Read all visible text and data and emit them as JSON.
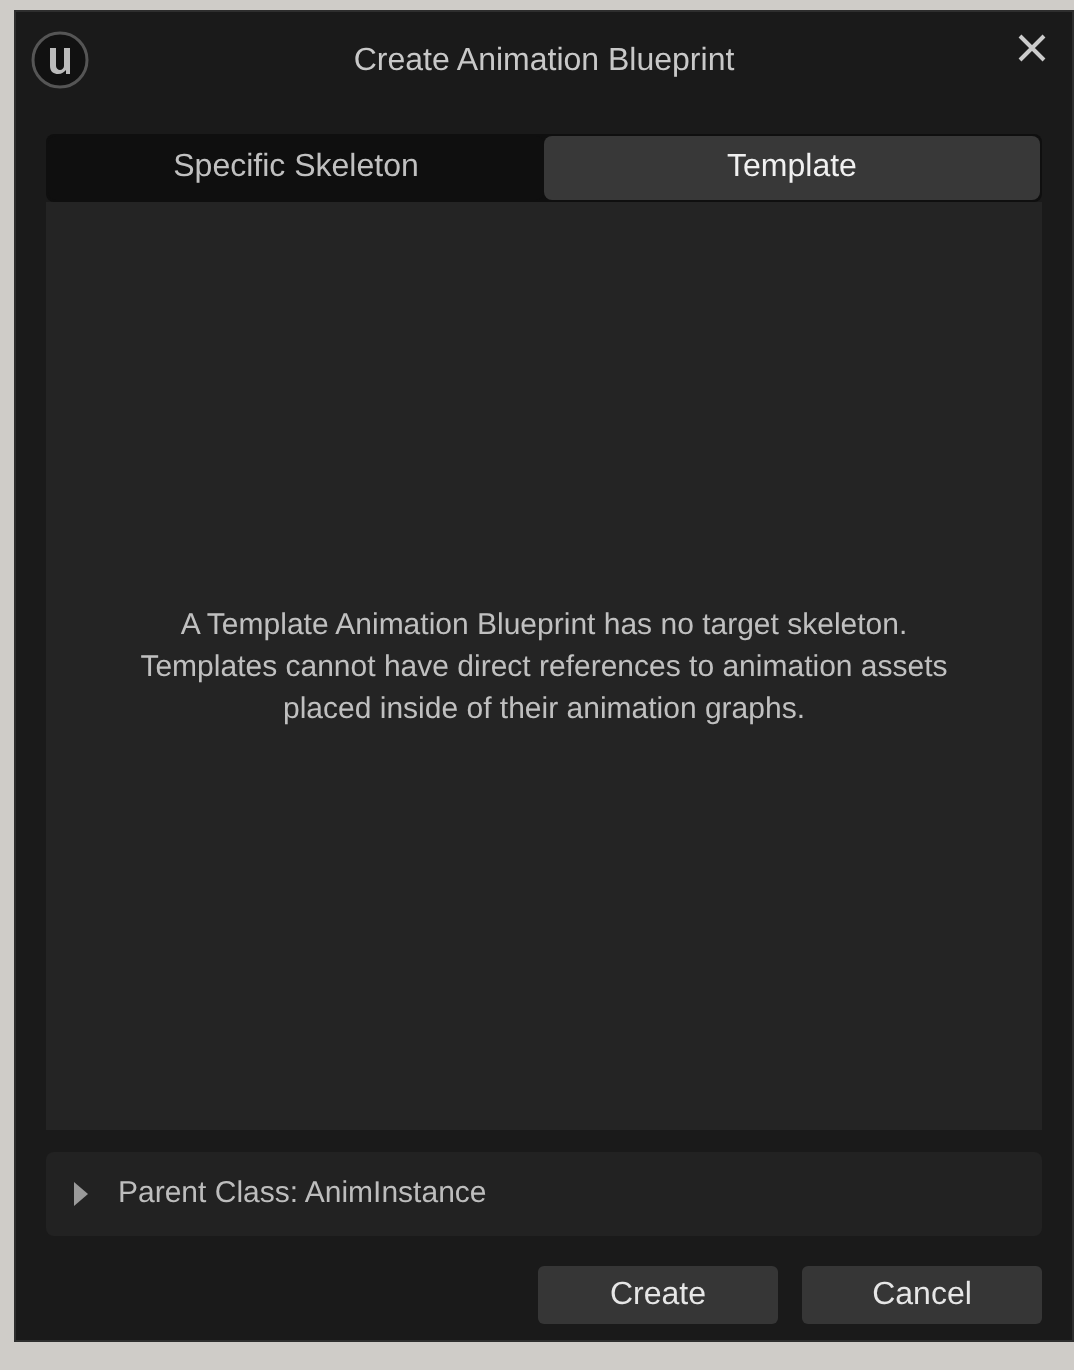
{
  "window": {
    "title": "Create Animation Blueprint"
  },
  "tabs": [
    {
      "label": "Specific Skeleton",
      "selected": false
    },
    {
      "label": "Template",
      "selected": true
    }
  ],
  "description_lines": [
    "A Template Animation Blueprint has no target skeleton.",
    "Templates cannot have direct references to animation assets",
    "placed inside of their animation graphs."
  ],
  "parent_class": {
    "label": "Parent Class: AnimInstance",
    "expanded": false
  },
  "buttons": [
    "Create",
    "Cancel"
  ]
}
